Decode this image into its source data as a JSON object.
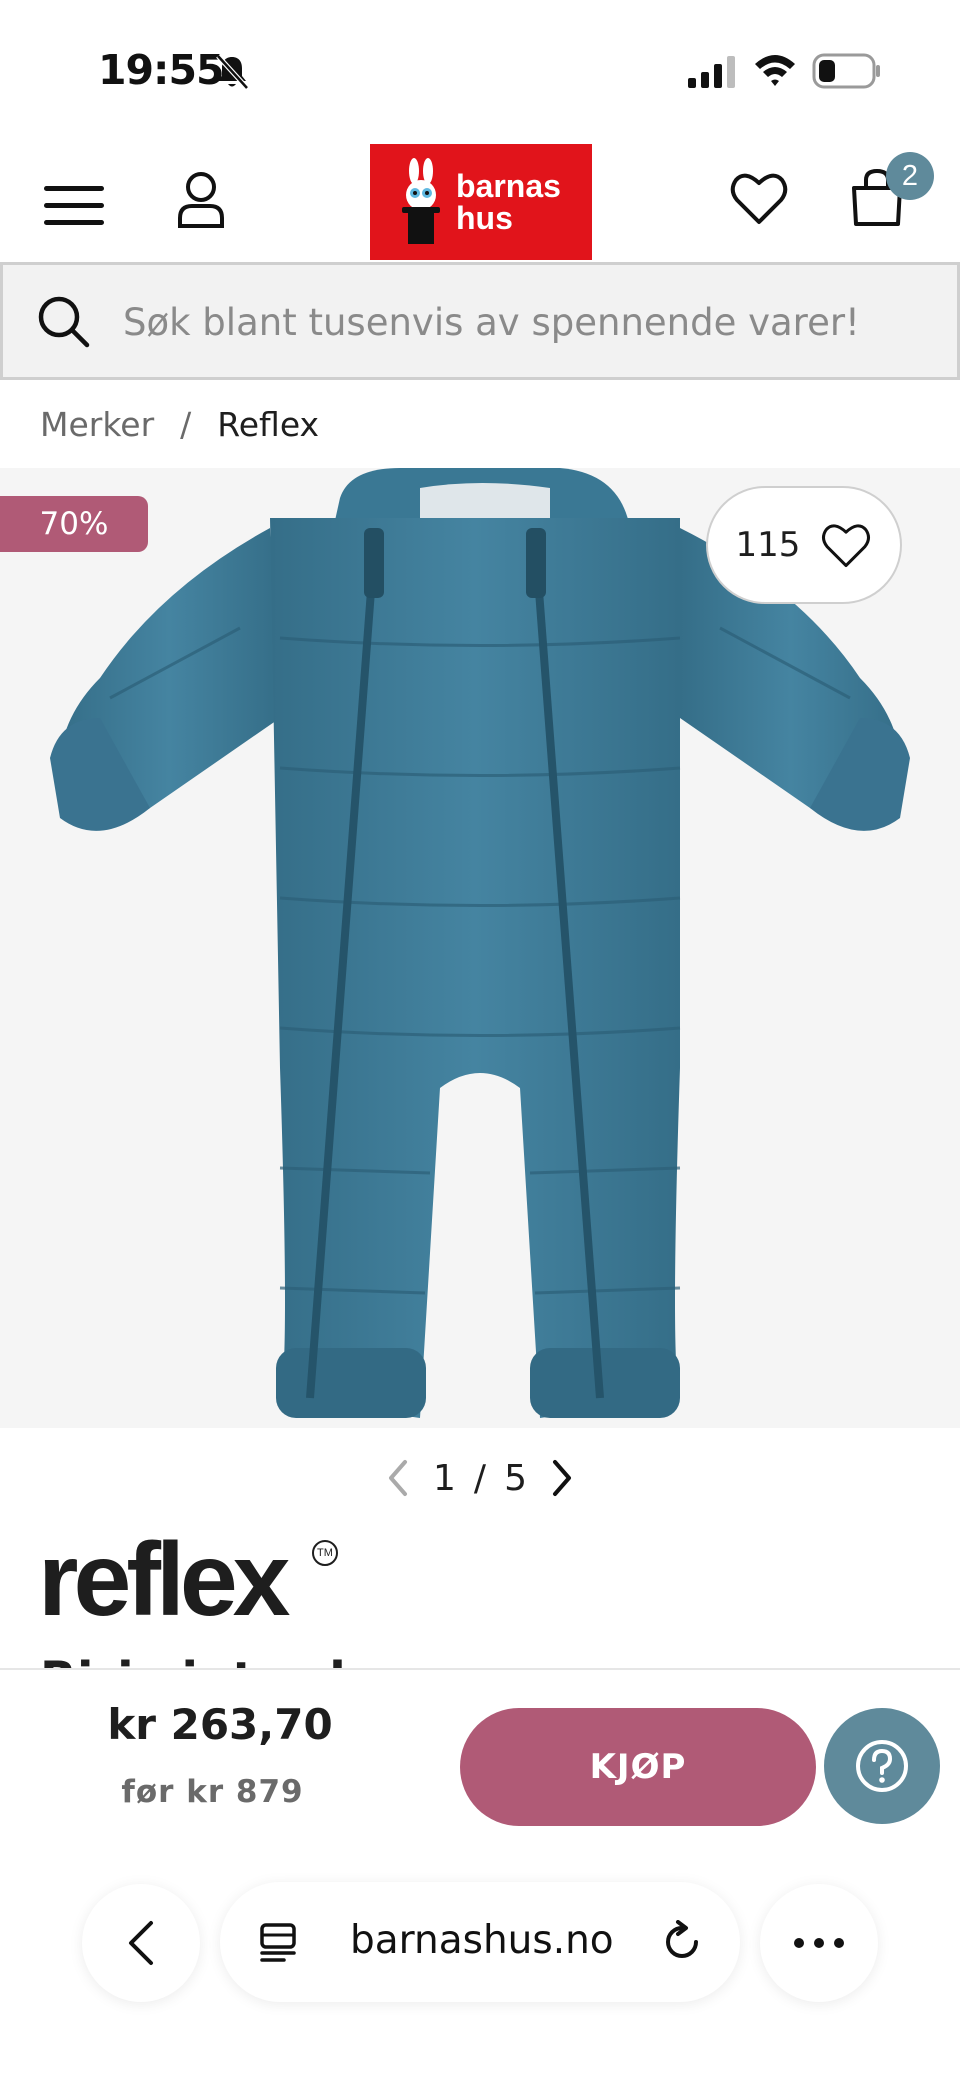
{
  "status_bar": {
    "time": "19:55",
    "icons": [
      "bell-slash-icon",
      "cellular-signal-icon",
      "wifi-icon",
      "battery-icon"
    ]
  },
  "header": {
    "logo_text_line1": "barnas",
    "logo_text_line2": "hus",
    "cart_count": "2",
    "icons": [
      "menu-icon",
      "user-icon",
      "heart-icon",
      "shopping-bag-icon"
    ]
  },
  "search": {
    "placeholder": "Søk blant tusenvis av spennende varer!"
  },
  "breadcrumb": {
    "parent": "Merker",
    "separator": "/",
    "current": "Reflex"
  },
  "product": {
    "discount": "70%",
    "likes": "115",
    "image_index": "1",
    "image_separator": "/",
    "image_total": "5",
    "brand": "reflex",
    "brand_tm": "TM",
    "title": "Riri vinterdress"
  },
  "purchase": {
    "price": "kr 263,70",
    "price_before": "før kr 879",
    "buy_label": "KJØP"
  },
  "browser": {
    "url": "barnashus.no"
  },
  "colors": {
    "brand_red": "#e1141b",
    "accent_pink": "#b05a76",
    "accent_blue": "#5f8a9b",
    "suit_blue": "#3d7b98"
  }
}
